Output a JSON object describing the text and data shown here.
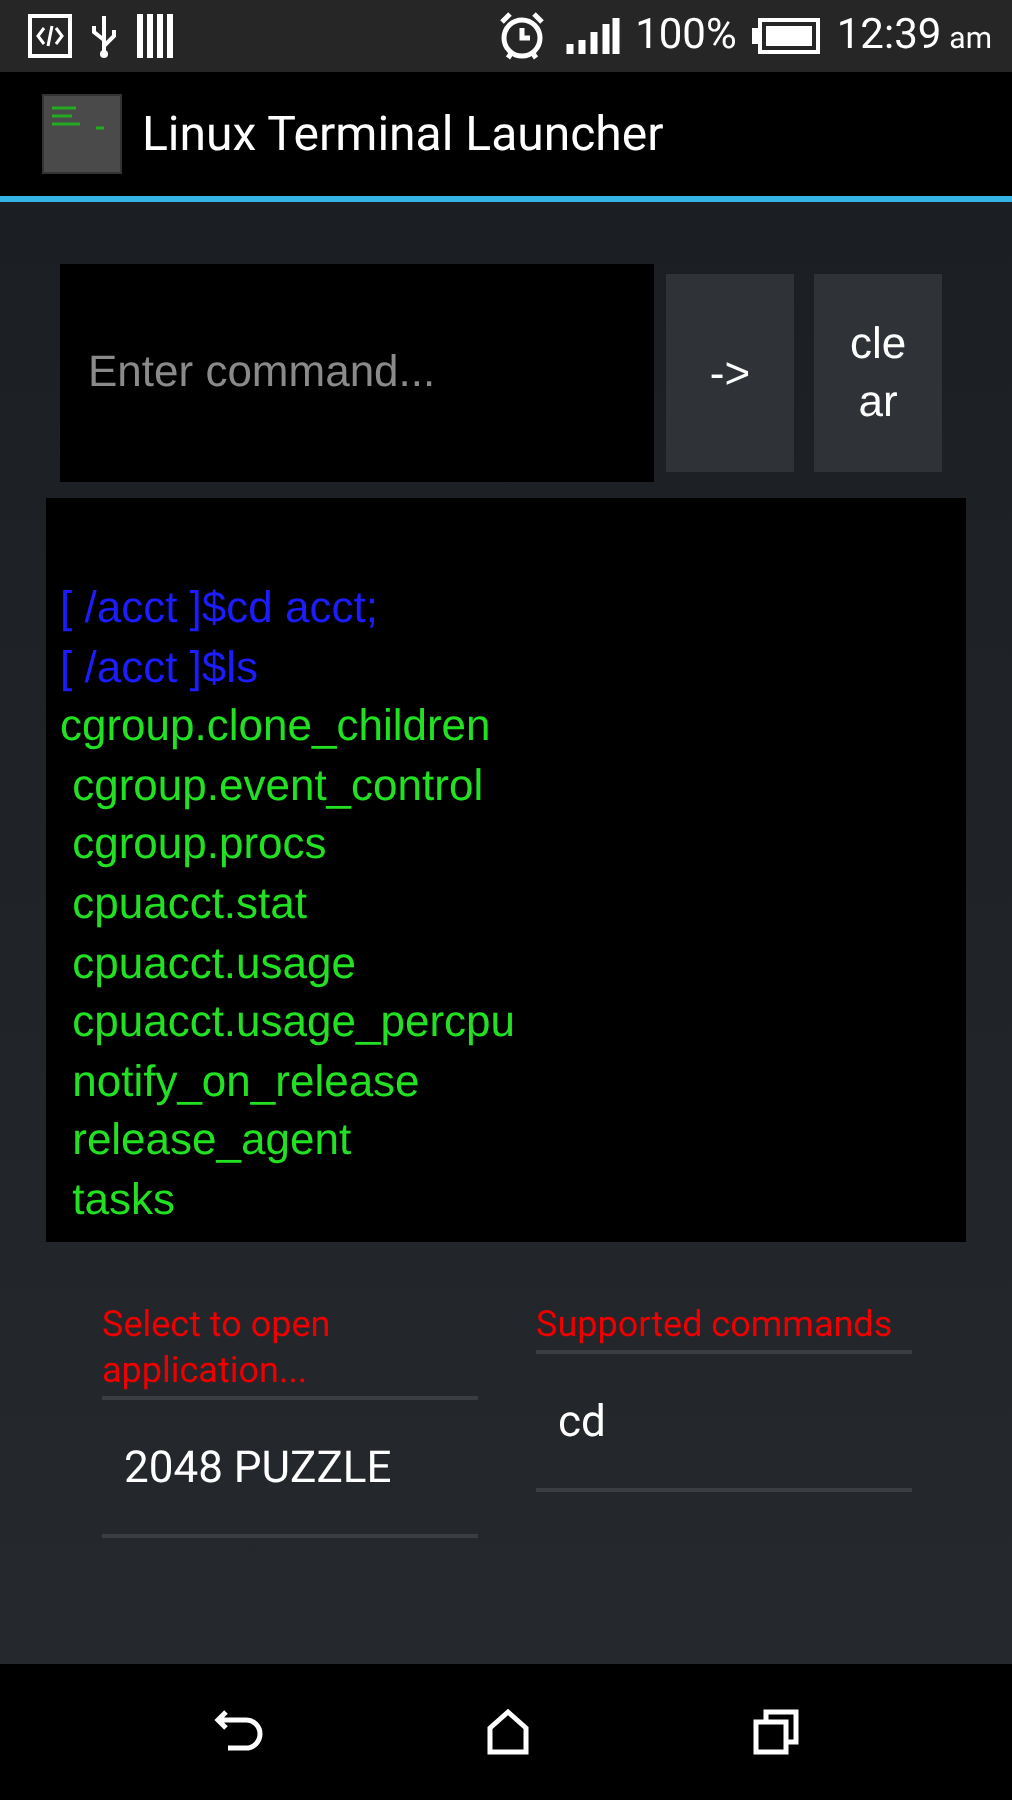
{
  "status_bar": {
    "battery": "100%",
    "time": "12:39",
    "ampm": "am"
  },
  "action_bar": {
    "title": "Linux Terminal Launcher"
  },
  "command": {
    "placeholder": "Enter command...",
    "buttons": [
      "->",
      "cle\nar"
    ]
  },
  "terminal": {
    "lines": [
      {
        "kind": "command",
        "text": "[ /acct ]$cd acct;"
      },
      {
        "kind": "command",
        "text": "[ /acct ]$ls"
      },
      {
        "kind": "output",
        "text": "cgroup.clone_children"
      },
      {
        "kind": "output",
        "text": " cgroup.event_control"
      },
      {
        "kind": "output",
        "text": " cgroup.procs"
      },
      {
        "kind": "output",
        "text": " cpuacct.stat"
      },
      {
        "kind": "output",
        "text": " cpuacct.usage"
      },
      {
        "kind": "output",
        "text": " cpuacct.usage_percpu"
      },
      {
        "kind": "output",
        "text": " notify_on_release"
      },
      {
        "kind": "output",
        "text": " release_agent"
      },
      {
        "kind": "output",
        "text": " tasks"
      }
    ]
  },
  "spinners": [
    {
      "label": "Select to open application...",
      "value": "2048 PUZZLE"
    },
    {
      "label": "Supported commands",
      "value": "cd"
    }
  ]
}
